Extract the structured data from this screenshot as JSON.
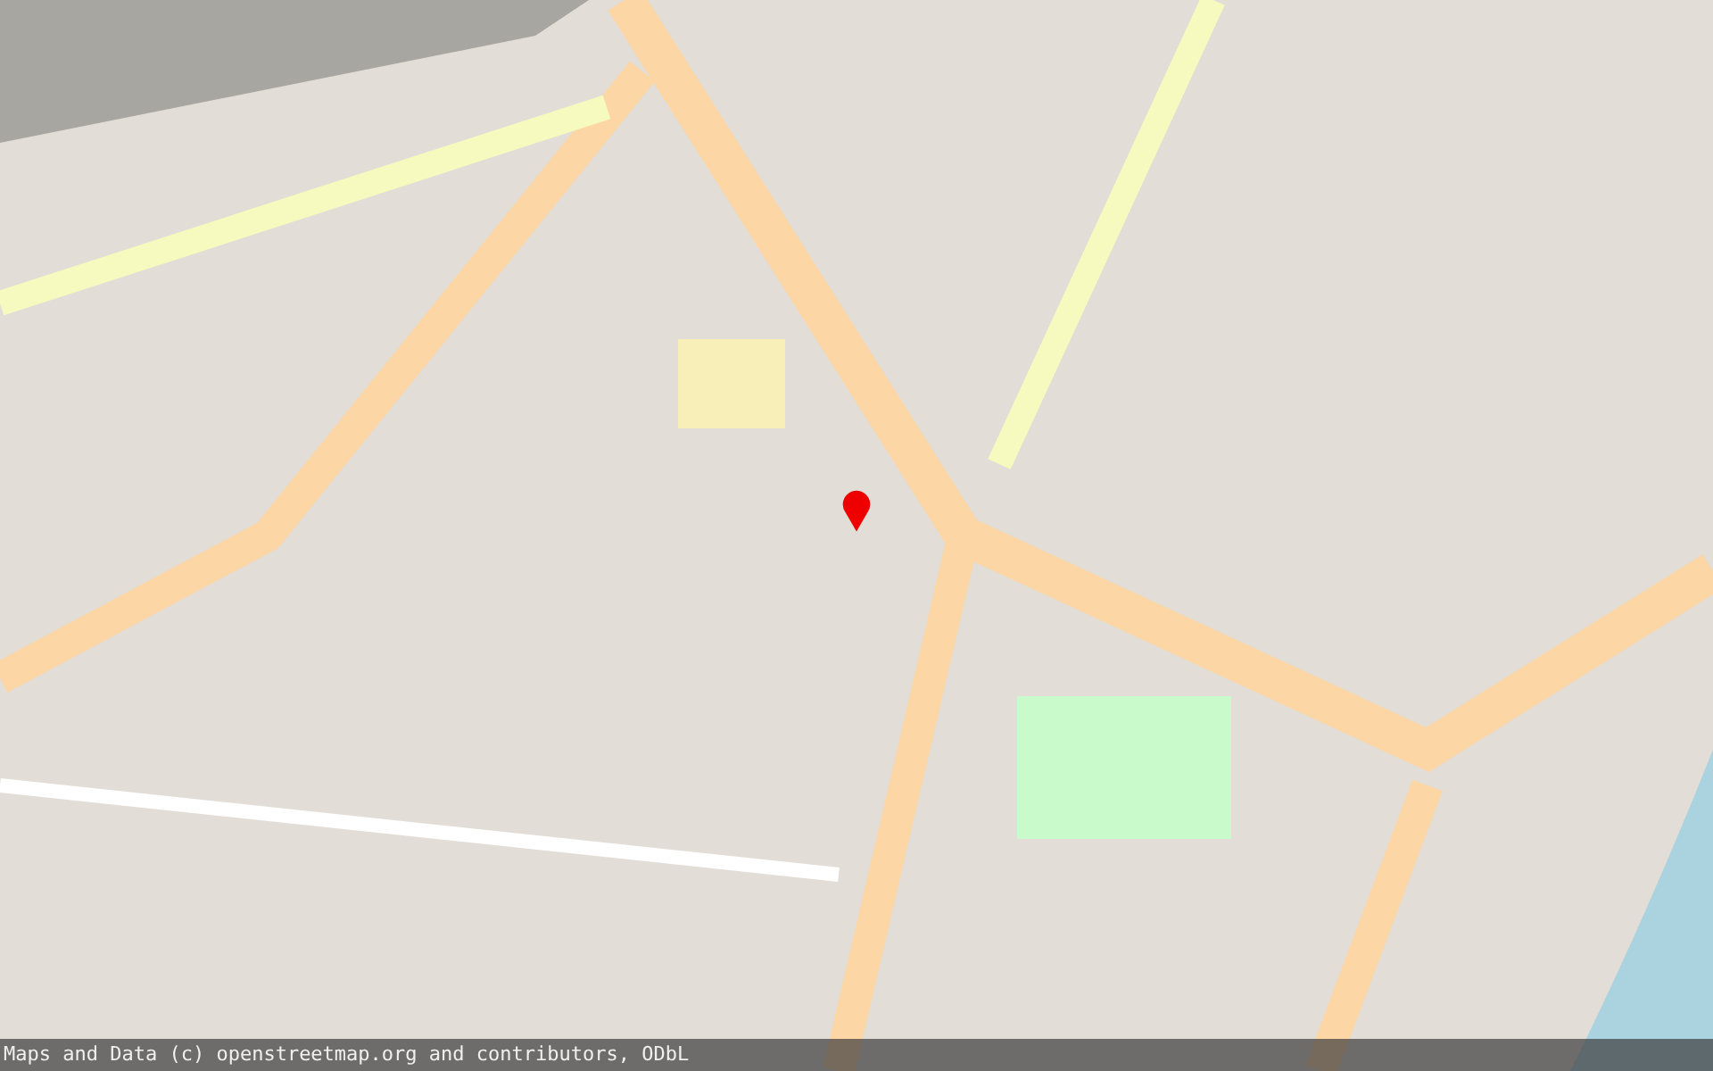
{
  "map": {
    "marker": {
      "color": "#ee0000"
    }
  },
  "attribution": "Maps and Data (c) openstreetmap.org and contributors, ODbL"
}
